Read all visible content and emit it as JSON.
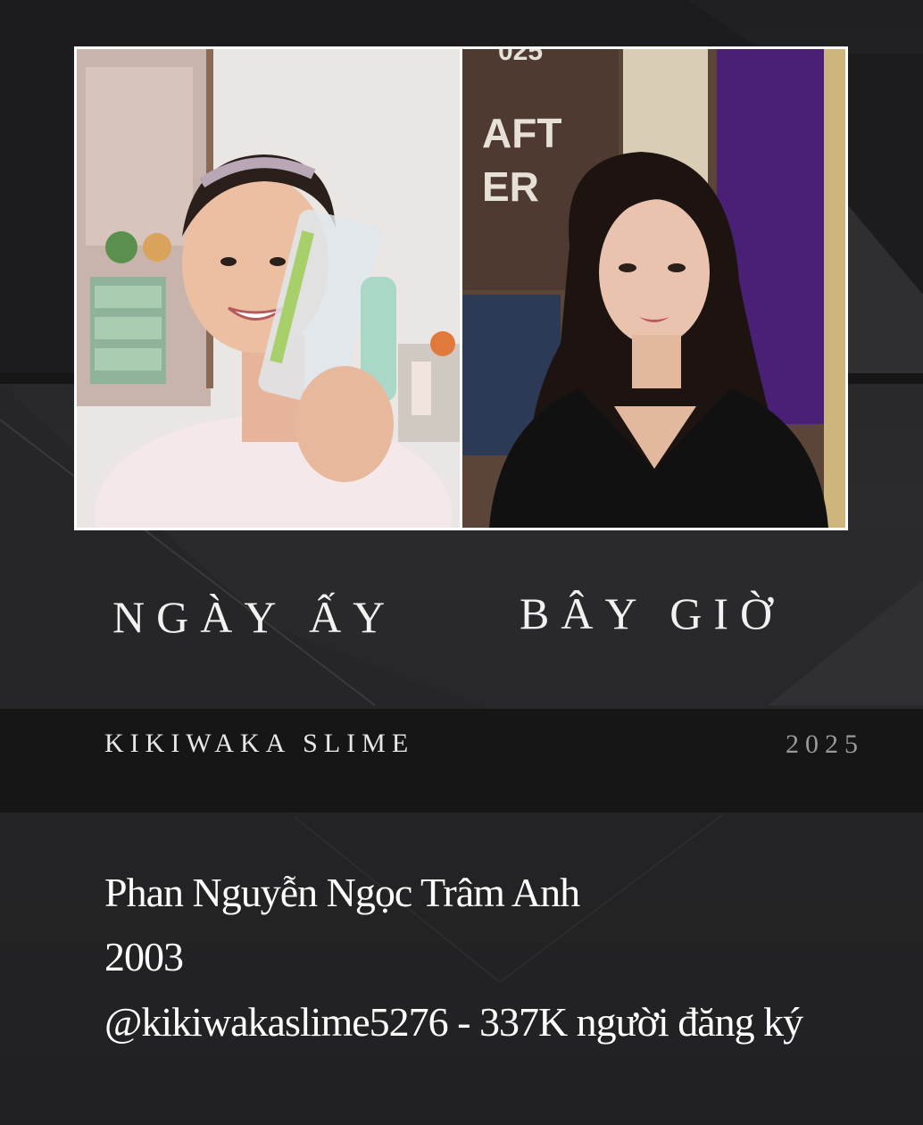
{
  "labels": {
    "before": "NGÀY ẤY",
    "after": "BÂY GIỜ"
  },
  "channel": {
    "name": "KIKIWAKA SLIME",
    "year": "2025"
  },
  "profile": {
    "full_name": "Phan Nguyễn Ngọc Trâm Anh",
    "birth_year": "2003",
    "handle_line": "@kikiwakaslime5276 - 337K người đăng ký"
  },
  "photo_text": {
    "sign_line1": "AFT",
    "sign_line2": "ER",
    "sign_top": "025"
  },
  "colors": {
    "background": "#2a2a2c",
    "band": "#161617",
    "text": "#ffffff",
    "year": "#9a9a9a"
  }
}
